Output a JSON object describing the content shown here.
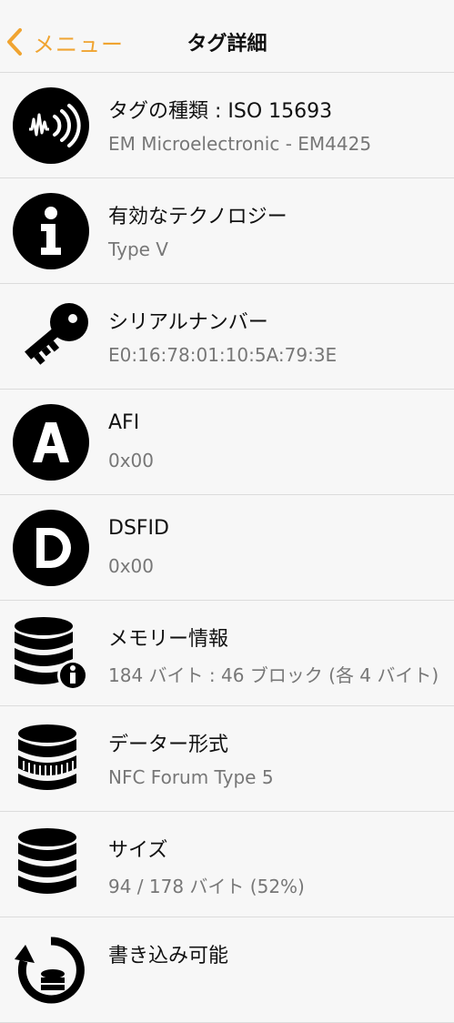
{
  "nav": {
    "back_label": "メニュー",
    "title": "タグ詳細",
    "accent_color": "#f0a431"
  },
  "rows": [
    {
      "icon": "nfc-tag-icon",
      "title": "タグの種類 : ISO 15693",
      "value": "EM Microelectronic - EM4425"
    },
    {
      "icon": "info-icon",
      "title": "有効なテクノロジー",
      "value": "Type V"
    },
    {
      "icon": "key-icon",
      "title": "シリアルナンバー",
      "value": "E0:16:78:01:10:5A:79:3E"
    },
    {
      "icon": "letter-a-icon",
      "title": "AFI",
      "value": "0x00"
    },
    {
      "icon": "letter-d-icon",
      "title": "DSFID",
      "value": "0x00"
    },
    {
      "icon": "database-info-icon",
      "title": "メモリー情報",
      "value": "184 バイト : 46 ブロック (各 4 バイト)"
    },
    {
      "icon": "coin-stack-icon",
      "title": "データー形式",
      "value": "NFC Forum Type 5"
    },
    {
      "icon": "database-icon",
      "title": "サイズ",
      "value": "94 / 178 バイト (52%)"
    },
    {
      "icon": "rotate-database-icon",
      "title": "書き込み可能",
      "value": ""
    }
  ]
}
